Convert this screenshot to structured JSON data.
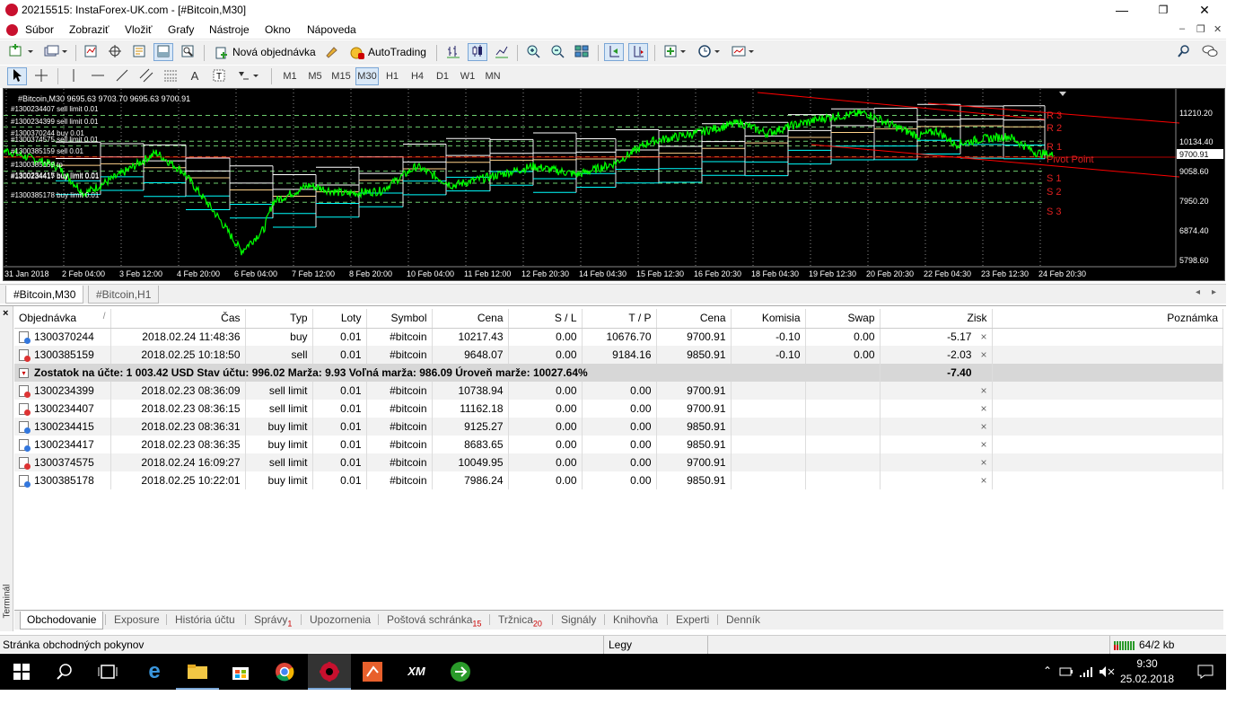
{
  "window": {
    "title": "20215515: InstaForex-UK.com - [#Bitcoin,M30]",
    "min": "—",
    "max": "❐",
    "close": "✕"
  },
  "menu": [
    "Súbor",
    "Zobraziť",
    "Vložiť",
    "Grafy",
    "Nástroje",
    "Okno",
    "Nápoveda"
  ],
  "toolbar": {
    "new_order": "Nová objednávka",
    "autotrading": "AutoTrading"
  },
  "periods": [
    "M1",
    "M5",
    "M15",
    "M30",
    "H1",
    "H4",
    "D1",
    "W1",
    "MN"
  ],
  "active_period": "M30",
  "chart": {
    "header": "#Bitcoin,M30  9695.63 9703.70 9695.63 9700.91",
    "order_labels": [
      "#1300234407 sell limit 0.01",
      "#1300234399 sell limit 0.01",
      "#1300370244 buy 0.01",
      "#1300374575 sell limit 0.01",
      "#1300385159 sell 0.01",
      "#1300385159 tp",
      "#1300234417 buy limit 0.01",
      "#1300234415 buy limit 0.01",
      "#1300385178 buy limit 0.01"
    ],
    "pivot_labels": [
      "R 3",
      "R 2",
      "R 1",
      "Pivot Point",
      "S 1",
      "S 2",
      "S 3"
    ],
    "price_axis": [
      "11210.20",
      "10134.40",
      "9700.91",
      "9058.60",
      "7950.20",
      "6874.40",
      "5798.60"
    ],
    "time_axis": [
      "31 Jan 2018",
      "2 Feb 04:00",
      "3 Feb 12:00",
      "4 Feb 20:00",
      "6 Feb 04:00",
      "7 Feb 12:00",
      "8 Feb 20:00",
      "10 Feb 04:00",
      "11 Feb 12:00",
      "12 Feb 20:30",
      "14 Feb 04:30",
      "15 Feb 12:30",
      "16 Feb 20:30",
      "18 Feb 04:30",
      "19 Feb 12:30",
      "20 Feb 20:30",
      "22 Feb 04:30",
      "23 Feb 12:30",
      "24 Feb 20:30"
    ],
    "colors": {
      "bg": "#000000",
      "line": "#00ff00",
      "grid": "#ffffff",
      "pivot": "#ff0000",
      "support": "#00ffff"
    }
  },
  "chart_tabs": [
    "#Bitcoin,M30",
    "#Bitcoin,H1"
  ],
  "terminal": {
    "side_label": "Terminál",
    "columns": [
      "Objednávka",
      "Čas",
      "Typ",
      "Loty",
      "Symbol",
      "Cena",
      "S / L",
      "T / P",
      "Cena",
      "Komisia",
      "Swap",
      "Zisk",
      "Poznámka"
    ],
    "open": [
      {
        "id": "1300370244",
        "time": "2018.02.24 11:48:36",
        "type": "buy",
        "lots": "0.01",
        "symbol": "#bitcoin",
        "price": "10217.43",
        "sl": "0.00",
        "tp": "10676.70",
        "cur": "9700.91",
        "comm": "-0.10",
        "swap": "0.00",
        "profit": "-5.17"
      },
      {
        "id": "1300385159",
        "time": "2018.02.25 10:18:50",
        "type": "sell",
        "lots": "0.01",
        "symbol": "#bitcoin",
        "price": "9648.07",
        "sl": "0.00",
        "tp": "9184.16",
        "cur": "9850.91",
        "comm": "-0.10",
        "swap": "0.00",
        "profit": "-2.03"
      }
    ],
    "balance": "Zostatok na účte: 1 003.42 USD  Stav účtu: 996.02  Marža: 9.93  Voľná marža: 986.09  Úroveň marže: 10027.64%",
    "balance_profit": "-7.40",
    "pending": [
      {
        "id": "1300234399",
        "time": "2018.02.23 08:36:09",
        "type": "sell limit",
        "lots": "0.01",
        "symbol": "#bitcoin",
        "price": "10738.94",
        "sl": "0.00",
        "tp": "0.00",
        "cur": "9700.91"
      },
      {
        "id": "1300234407",
        "time": "2018.02.23 08:36:15",
        "type": "sell limit",
        "lots": "0.01",
        "symbol": "#bitcoin",
        "price": "11162.18",
        "sl": "0.00",
        "tp": "0.00",
        "cur": "9700.91"
      },
      {
        "id": "1300234415",
        "time": "2018.02.23 08:36:31",
        "type": "buy limit",
        "lots": "0.01",
        "symbol": "#bitcoin",
        "price": "9125.27",
        "sl": "0.00",
        "tp": "0.00",
        "cur": "9850.91"
      },
      {
        "id": "1300234417",
        "time": "2018.02.23 08:36:35",
        "type": "buy limit",
        "lots": "0.01",
        "symbol": "#bitcoin",
        "price": "8683.65",
        "sl": "0.00",
        "tp": "0.00",
        "cur": "9850.91"
      },
      {
        "id": "1300374575",
        "time": "2018.02.24 16:09:27",
        "type": "sell limit",
        "lots": "0.01",
        "symbol": "#bitcoin",
        "price": "10049.95",
        "sl": "0.00",
        "tp": "0.00",
        "cur": "9700.91"
      },
      {
        "id": "1300385178",
        "time": "2018.02.25 10:22:01",
        "type": "buy limit",
        "lots": "0.01",
        "symbol": "#bitcoin",
        "price": "7986.24",
        "sl": "0.00",
        "tp": "0.00",
        "cur": "9850.91"
      }
    ],
    "tabs": [
      {
        "label": "Obchodovanie",
        "badge": ""
      },
      {
        "label": "Exposure",
        "badge": ""
      },
      {
        "label": "História účtu",
        "badge": ""
      },
      {
        "label": "Správy",
        "badge": "1"
      },
      {
        "label": "Upozornenia",
        "badge": ""
      },
      {
        "label": "Poštová schránka",
        "badge": "15"
      },
      {
        "label": "Tržnica",
        "badge": "20"
      },
      {
        "label": "Signály",
        "badge": ""
      },
      {
        "label": "Knihovňa",
        "badge": ""
      },
      {
        "label": "Experti",
        "badge": ""
      },
      {
        "label": "Denník",
        "badge": ""
      }
    ]
  },
  "status": {
    "left": "Stránka obchodných pokynov",
    "mid": "Legy",
    "right": "64/2 kb"
  },
  "taskbar": {
    "time": "9:30",
    "date": "25.02.2018"
  }
}
